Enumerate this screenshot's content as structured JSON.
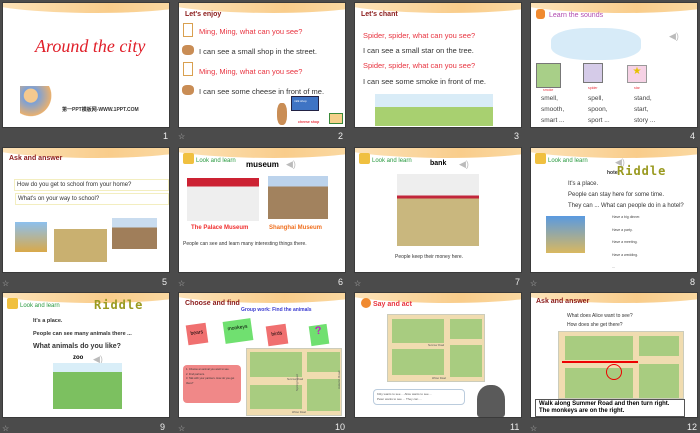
{
  "slides": [
    {
      "number": "1",
      "title": "Around the city",
      "footer": "第一PPT模板网-WWW.1PPT.COM"
    },
    {
      "number": "2",
      "heading": "Let's enjoy",
      "lines": [
        "Ming, Ming, what can you see?",
        "I can see a small shop in the street.",
        "Ming, Ming, what can you see?",
        "I can see some cheese in front of me."
      ],
      "sign": "milk shop",
      "arrow_label": "cheese shop"
    },
    {
      "number": "3",
      "heading": "Let's chant",
      "lines": [
        "Spider, spider, what can you see?",
        "I can see a small star on the tree.",
        "Spider, spider, what can you see?",
        "I can see some smoke in front of me."
      ]
    },
    {
      "number": "4",
      "heading": "Learn the sounds",
      "cards": [
        "smoke",
        "spider",
        "star"
      ],
      "words": [
        [
          "smell,",
          "smooth,",
          "smart ..."
        ],
        [
          "spell,",
          "spoon,",
          "sport ..."
        ],
        [
          "stand,",
          "start,",
          "story ..."
        ]
      ]
    },
    {
      "number": "5",
      "heading": "Ask and answer",
      "questions": [
        "How do you get to school from your home?",
        "What's on your way to school?"
      ]
    },
    {
      "number": "6",
      "heading": "Look and learn",
      "word": "museum",
      "captions": [
        "The Palace Museum",
        "Shanghai Museum"
      ],
      "sentence": "People can see and learn many interesting things there."
    },
    {
      "number": "7",
      "heading": "Look and learn",
      "word": "bank",
      "sentence": "People keep their money here."
    },
    {
      "number": "8",
      "heading": "Look and learn",
      "riddle": "Riddle",
      "word": "hotel",
      "lines": [
        "It's a place.",
        "People can stay here for some time.",
        "They can ... What can people do in a hotel?"
      ],
      "options": [
        "Have a big dinner.",
        "Have a party.",
        "Have a meeting.",
        "Have a wedding.",
        "..."
      ]
    },
    {
      "number": "9",
      "heading": "Look and learn",
      "riddle": "Riddle",
      "lines": [
        "It's a place.",
        "People can see many animals there ...",
        "What animals do you like?"
      ],
      "word": "zoo"
    },
    {
      "number": "10",
      "heading": "Choose and find",
      "subheading": "Group work: Find the animals",
      "notes": [
        "bears",
        "monkeys",
        "birds",
        "?"
      ],
      "steps": [
        "1. Choose an animal you want to see.",
        "2. Find partners.",
        "3. Talk with your partners. How do you get there?"
      ],
      "roads": [
        "Summer Road",
        "Winter Road",
        "Spring Road",
        "Autumn Road"
      ]
    },
    {
      "number": "11",
      "heading": "Say and act",
      "bubble": [
        "Kitty wants to see ... Alice wants to see ...",
        "Peter wants to see ... They can ..."
      ],
      "roads": [
        "Summer Road",
        "Winter Road"
      ]
    },
    {
      "number": "12",
      "heading": "Ask and answer",
      "questions": [
        "What does Alice want to see?",
        "How does she get there?"
      ],
      "answer": "Walk along Summer Road and then turn right. The monkeys are on the right."
    }
  ]
}
